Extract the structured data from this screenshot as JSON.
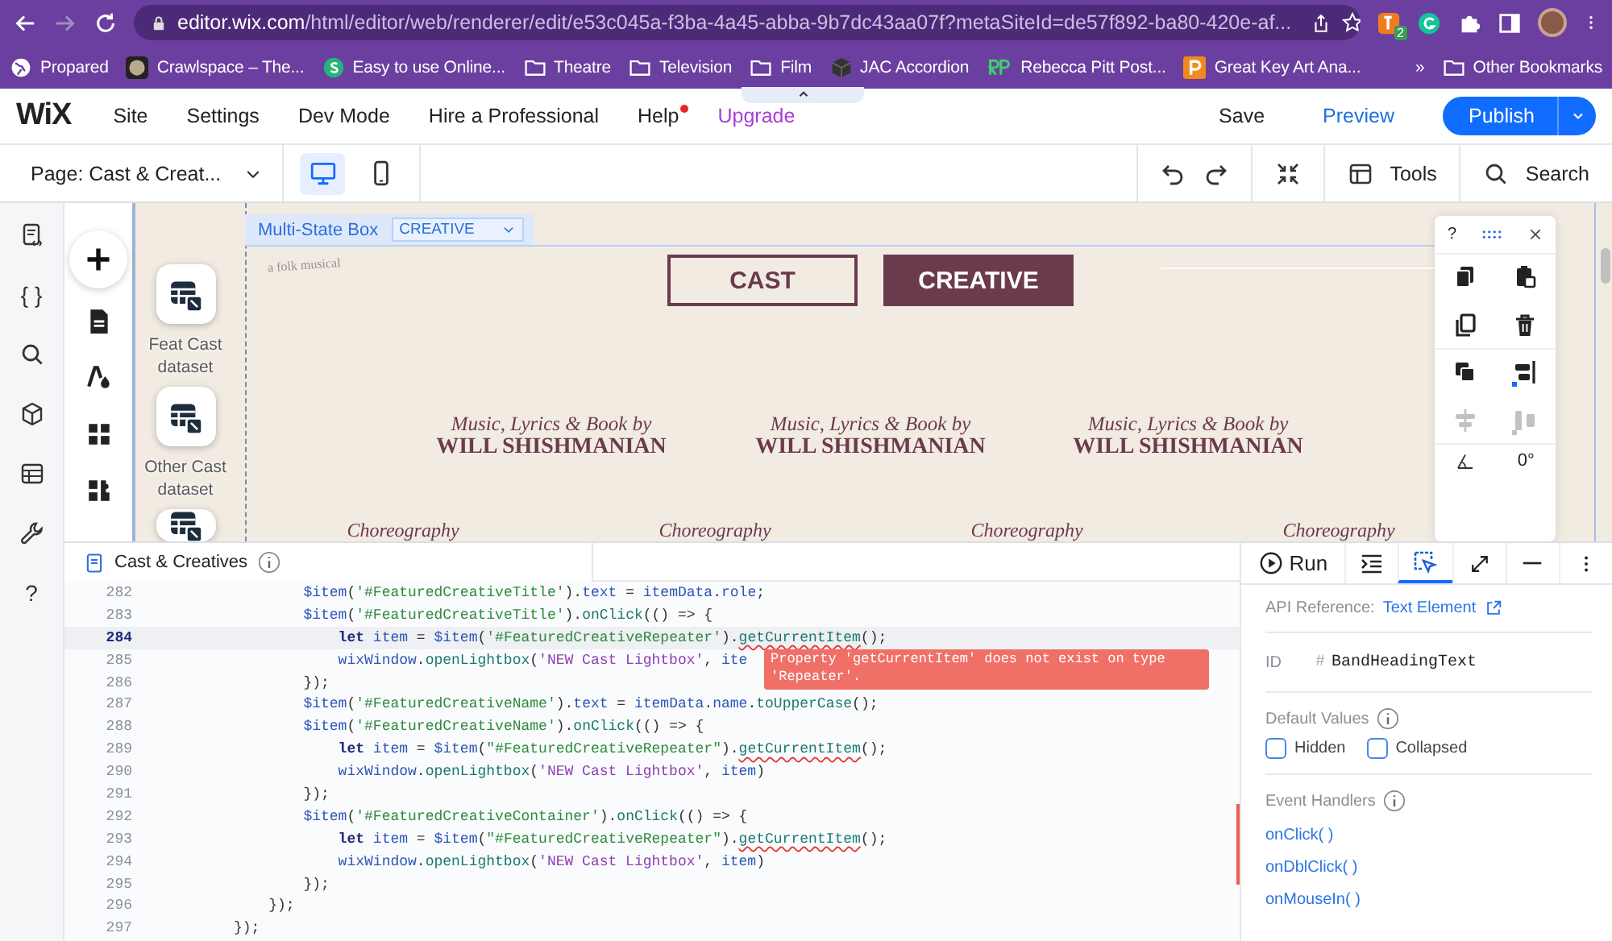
{
  "browser": {
    "url_host": "editor.wix.com",
    "url_path": "/html/editor/web/renderer/edit/e53c045a-f3ba-4a45-abba-9b7dc43aa07f?metaSiteId=de57f892-ba80-420e-af...",
    "extension_badge": "2"
  },
  "bookmarks": [
    {
      "label": "Propared",
      "kind": "globe"
    },
    {
      "label": "Crawlspace – The...",
      "kind": "thumb"
    },
    {
      "label": "Easy to use Online...",
      "kind": "s-logo"
    },
    {
      "label": "Theatre",
      "kind": "folder"
    },
    {
      "label": "Television",
      "kind": "folder"
    },
    {
      "label": "Film",
      "kind": "folder"
    },
    {
      "label": "JAC Accordion",
      "kind": "cube"
    },
    {
      "label": "Rebecca Pitt Post...",
      "kind": "rp-logo"
    },
    {
      "label": "Great Key Art Ana...",
      "kind": "p-logo"
    }
  ],
  "bookmarks_more": "»",
  "other_bookmarks": "Other Bookmarks",
  "wix": {
    "logo": "WiX",
    "menu": [
      {
        "label": "Site",
        "kind": "plain",
        "notify": false
      },
      {
        "label": "Settings",
        "kind": "plain",
        "notify": false
      },
      {
        "label": "Dev Mode",
        "kind": "plain",
        "notify": false
      },
      {
        "label": "Hire a Professional",
        "kind": "plain",
        "notify": false
      },
      {
        "label": "Help",
        "kind": "plain",
        "notify": true
      },
      {
        "label": "Upgrade",
        "kind": "upgrade",
        "notify": false
      }
    ],
    "save": "Save",
    "preview": "Preview",
    "publish": "Publish",
    "page_select": "Page: Cast & Creat...",
    "views": [
      {
        "kind": "desktop",
        "selected": true
      },
      {
        "kind": "mobile",
        "selected": false
      }
    ],
    "tools": "Tools",
    "search": "Search"
  },
  "rail": [
    {
      "kind": "page-code"
    },
    {
      "kind": "glyph",
      "glyph": "{ }"
    },
    {
      "kind": "search"
    },
    {
      "kind": "cube"
    },
    {
      "kind": "table"
    },
    {
      "kind": "wrench"
    },
    {
      "kind": "glyph",
      "glyph": "?"
    }
  ],
  "add_panel": [
    {
      "kind": "add"
    },
    {
      "kind": "page"
    },
    {
      "kind": "theme"
    },
    {
      "kind": "apps"
    },
    {
      "kind": "plugins"
    }
  ],
  "datasets": [
    {
      "kind": "full",
      "label": "Feat Cast dataset"
    },
    {
      "kind": "full",
      "label": "Other Cast dataset"
    },
    {
      "kind": "cut"
    }
  ],
  "multi_state": {
    "label": "Multi-State Box",
    "state": "CREATIVE"
  },
  "site": {
    "tagline": "a folk musical",
    "state_buttons": [
      {
        "label": "CAST",
        "selected": false
      },
      {
        "label": "CREATIVE",
        "selected": true
      }
    ],
    "credits": [
      {
        "role": "Music, Lyrics & Book by",
        "name": "WILL SHISHMANIAN"
      },
      {
        "role": "Music, Lyrics & Book by",
        "name": "WILL SHISHMANIAN"
      },
      {
        "role": "Music, Lyrics & Book by",
        "name": "WILL SHISHMANIAN"
      }
    ],
    "roles": [
      "Choreography",
      "Choreography",
      "Choreography",
      "Choreography"
    ]
  },
  "float_panel": {
    "help": "?",
    "rotation": "0°",
    "tools": [
      {
        "kind": "copy-design",
        "disabled": false
      },
      {
        "kind": "paste-design",
        "disabled": false
      },
      {
        "kind": "duplicate",
        "disabled": false
      },
      {
        "kind": "delete",
        "disabled": false
      },
      {
        "kind": "arrange",
        "disabled": false
      },
      {
        "kind": "align",
        "disabled": false
      },
      {
        "kind": "distribute",
        "disabled": true
      },
      {
        "kind": "match-size",
        "disabled": true
      }
    ]
  },
  "code_panel": {
    "file": "Cast & Creatives",
    "lines": [
      {
        "number": "282",
        "current": false,
        "tokens": [
          {
            "kind": "v",
            "text": "        $item"
          },
          {
            "kind": "p",
            "text": "("
          },
          {
            "kind": "s",
            "text": "'#FeaturedCreativeTitle'"
          },
          {
            "kind": "p",
            "text": ")."
          },
          {
            "kind": "v",
            "text": "text"
          },
          {
            "kind": "p",
            "text": " = "
          },
          {
            "kind": "v",
            "text": "itemData"
          },
          {
            "kind": "p",
            "text": "."
          },
          {
            "kind": "v",
            "text": "role"
          },
          {
            "kind": "p",
            "text": ";"
          }
        ]
      },
      {
        "number": "283",
        "current": false,
        "tokens": [
          {
            "kind": "v",
            "text": "        $item"
          },
          {
            "kind": "p",
            "text": "("
          },
          {
            "kind": "s",
            "text": "'#FeaturedCreativeTitle'"
          },
          {
            "kind": "p",
            "text": ")."
          },
          {
            "kind": "f",
            "text": "onClick"
          },
          {
            "kind": "p",
            "text": "(() => {"
          }
        ]
      },
      {
        "number": "284",
        "current": true,
        "tokens": [
          {
            "kind": "k",
            "text": "            let "
          },
          {
            "kind": "v",
            "text": "item"
          },
          {
            "kind": "p",
            "text": " = "
          },
          {
            "kind": "v",
            "text": "$item"
          },
          {
            "kind": "p",
            "text": "("
          },
          {
            "kind": "s",
            "text": "'#FeaturedCreativeRepeater'"
          },
          {
            "kind": "p",
            "text": ")."
          },
          {
            "kind": "e",
            "text": "getCurrentItem"
          },
          {
            "kind": "p",
            "text": "();"
          }
        ]
      },
      {
        "number": "285",
        "current": false,
        "tokens": [
          {
            "kind": "v",
            "text": "            wixWindow"
          },
          {
            "kind": "p",
            "text": "."
          },
          {
            "kind": "f",
            "text": "openLightbox"
          },
          {
            "kind": "p",
            "text": "("
          },
          {
            "kind": "s2",
            "text": "'NEW Cast Lightbox'"
          },
          {
            "kind": "p",
            "text": ", "
          },
          {
            "kind": "v",
            "text": "ite"
          }
        ],
        "error": "Property 'getCurrentItem' does not exist on type 'Repeater'."
      },
      {
        "number": "286",
        "current": false,
        "tokens": [
          {
            "kind": "p",
            "text": "        });"
          }
        ]
      },
      {
        "number": "287",
        "current": false,
        "tokens": [
          {
            "kind": "v",
            "text": "        $item"
          },
          {
            "kind": "p",
            "text": "("
          },
          {
            "kind": "s",
            "text": "'#FeaturedCreativeName'"
          },
          {
            "kind": "p",
            "text": ")."
          },
          {
            "kind": "v",
            "text": "text"
          },
          {
            "kind": "p",
            "text": " = "
          },
          {
            "kind": "v",
            "text": "itemData"
          },
          {
            "kind": "p",
            "text": "."
          },
          {
            "kind": "v",
            "text": "name"
          },
          {
            "kind": "p",
            "text": "."
          },
          {
            "kind": "f",
            "text": "toUpperCase"
          },
          {
            "kind": "p",
            "text": "();"
          }
        ]
      },
      {
        "number": "288",
        "current": false,
        "tokens": [
          {
            "kind": "v",
            "text": "        $item"
          },
          {
            "kind": "p",
            "text": "("
          },
          {
            "kind": "s",
            "text": "'#FeaturedCreativeName'"
          },
          {
            "kind": "p",
            "text": ")."
          },
          {
            "kind": "f",
            "text": "onClick"
          },
          {
            "kind": "p",
            "text": "(() => {"
          }
        ]
      },
      {
        "number": "289",
        "current": false,
        "tokens": [
          {
            "kind": "k",
            "text": "            let "
          },
          {
            "kind": "v",
            "text": "item"
          },
          {
            "kind": "p",
            "text": " = "
          },
          {
            "kind": "v",
            "text": "$item"
          },
          {
            "kind": "p",
            "text": "("
          },
          {
            "kind": "s",
            "text": "\"#FeaturedCreativeRepeater\""
          },
          {
            "kind": "p",
            "text": ")."
          },
          {
            "kind": "e",
            "text": "getCurrentItem"
          },
          {
            "kind": "p",
            "text": "();"
          }
        ]
      },
      {
        "number": "290",
        "current": false,
        "tokens": [
          {
            "kind": "v",
            "text": "            wixWindow"
          },
          {
            "kind": "p",
            "text": "."
          },
          {
            "kind": "f",
            "text": "openLightbox"
          },
          {
            "kind": "p",
            "text": "("
          },
          {
            "kind": "s2",
            "text": "'NEW Cast Lightbox'"
          },
          {
            "kind": "p",
            "text": ", "
          },
          {
            "kind": "v",
            "text": "item"
          },
          {
            "kind": "p",
            "text": ")"
          }
        ]
      },
      {
        "number": "291",
        "current": false,
        "tokens": [
          {
            "kind": "p",
            "text": "        });"
          }
        ]
      },
      {
        "number": "292",
        "current": false,
        "tokens": [
          {
            "kind": "v",
            "text": "        $item"
          },
          {
            "kind": "p",
            "text": "("
          },
          {
            "kind": "s",
            "text": "'#FeaturedCreativeContainer'"
          },
          {
            "kind": "p",
            "text": ")."
          },
          {
            "kind": "f",
            "text": "onClick"
          },
          {
            "kind": "p",
            "text": "(() => {"
          }
        ]
      },
      {
        "number": "293",
        "current": false,
        "tokens": [
          {
            "kind": "k",
            "text": "            let "
          },
          {
            "kind": "v",
            "text": "item"
          },
          {
            "kind": "p",
            "text": " = "
          },
          {
            "kind": "v",
            "text": "$item"
          },
          {
            "kind": "p",
            "text": "("
          },
          {
            "kind": "s",
            "text": "\"#FeaturedCreativeRepeater\""
          },
          {
            "kind": "p",
            "text": ")."
          },
          {
            "kind": "e",
            "text": "getCurrentItem"
          },
          {
            "kind": "p",
            "text": "();"
          }
        ]
      },
      {
        "number": "294",
        "current": false,
        "tokens": [
          {
            "kind": "v",
            "text": "            wixWindow"
          },
          {
            "kind": "p",
            "text": "."
          },
          {
            "kind": "f",
            "text": "openLightbox"
          },
          {
            "kind": "p",
            "text": "("
          },
          {
            "kind": "s2",
            "text": "'NEW Cast Lightbox'"
          },
          {
            "kind": "p",
            "text": ", "
          },
          {
            "kind": "v",
            "text": "item"
          },
          {
            "kind": "p",
            "text": ")"
          }
        ]
      },
      {
        "number": "295",
        "current": false,
        "tokens": [
          {
            "kind": "p",
            "text": "        });"
          }
        ]
      },
      {
        "number": "296",
        "current": false,
        "tokens": [
          {
            "kind": "p",
            "text": "    });"
          }
        ]
      },
      {
        "number": "297",
        "current": false,
        "tokens": [
          {
            "kind": "p",
            "text": "});"
          }
        ]
      }
    ]
  },
  "toolbar": [
    {
      "kind": "run",
      "label": "Run",
      "selected": false
    },
    {
      "kind": "outline",
      "selected": false
    },
    {
      "kind": "properties",
      "selected": true
    },
    {
      "kind": "expand",
      "selected": false
    },
    {
      "kind": "minimize",
      "selected": false
    },
    {
      "kind": "more",
      "selected": false
    }
  ],
  "properties": {
    "api_label": "API Reference:",
    "api_link": "Text Element",
    "id_label": "ID",
    "id_prefix": "#",
    "id_value": "BandHeadingText",
    "defaults_label": "Default Values",
    "checkboxes": [
      {
        "label": "Hidden",
        "checked": false
      },
      {
        "label": "Collapsed",
        "checked": false
      }
    ],
    "handlers_label": "Event Handlers",
    "handlers": [
      "onClick( )",
      "onDblClick( )",
      "onMouseIn( )"
    ]
  }
}
